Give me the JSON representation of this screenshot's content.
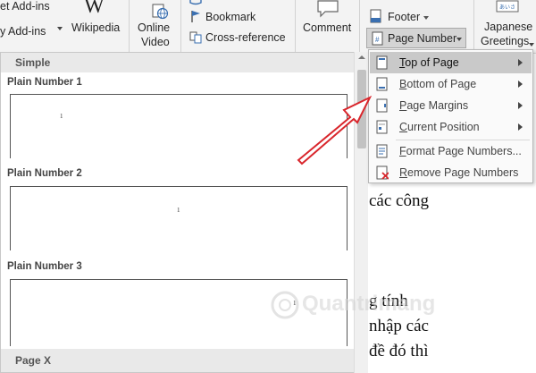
{
  "ribbon": {
    "get_addins": "et Add-ins",
    "my_addins": "y Add-ins",
    "wikipedia_glyph": "W",
    "wikipedia": "Wikipedia",
    "online": "Online",
    "video": "Video",
    "bookmark": "Bookmark",
    "cross_reference": "Cross-reference",
    "comment": "Comment",
    "footer": "Footer",
    "page_number": "Page Number",
    "japanese": "Japanese",
    "greetings": "Greetings"
  },
  "gallery": {
    "section_simple": "Simple",
    "items": [
      {
        "label": "Plain Number 1",
        "num": "1"
      },
      {
        "label": "Plain Number 2",
        "num": "1"
      },
      {
        "label": "Plain Number 3",
        "num": "1"
      }
    ],
    "section_page_x": "Page X"
  },
  "menu": {
    "top_of_page": "Top of Page",
    "bottom_of_page": "Bottom of Page",
    "page_margins": "Page Margins",
    "current_position": "Current Position",
    "format_page_numbers": "Format Page Numbers...",
    "remove_page_numbers": "Remove Page Numbers"
  },
  "document": {
    "line1": "các công",
    "line2": "g tính",
    "line3": "nhập các",
    "line4": "đề đó thì"
  },
  "watermark": "Quantrimang",
  "colors": {
    "arrow": "#d9262c",
    "menu_active": "#c9c9c9",
    "icon_blue": "#3a6fb0"
  }
}
